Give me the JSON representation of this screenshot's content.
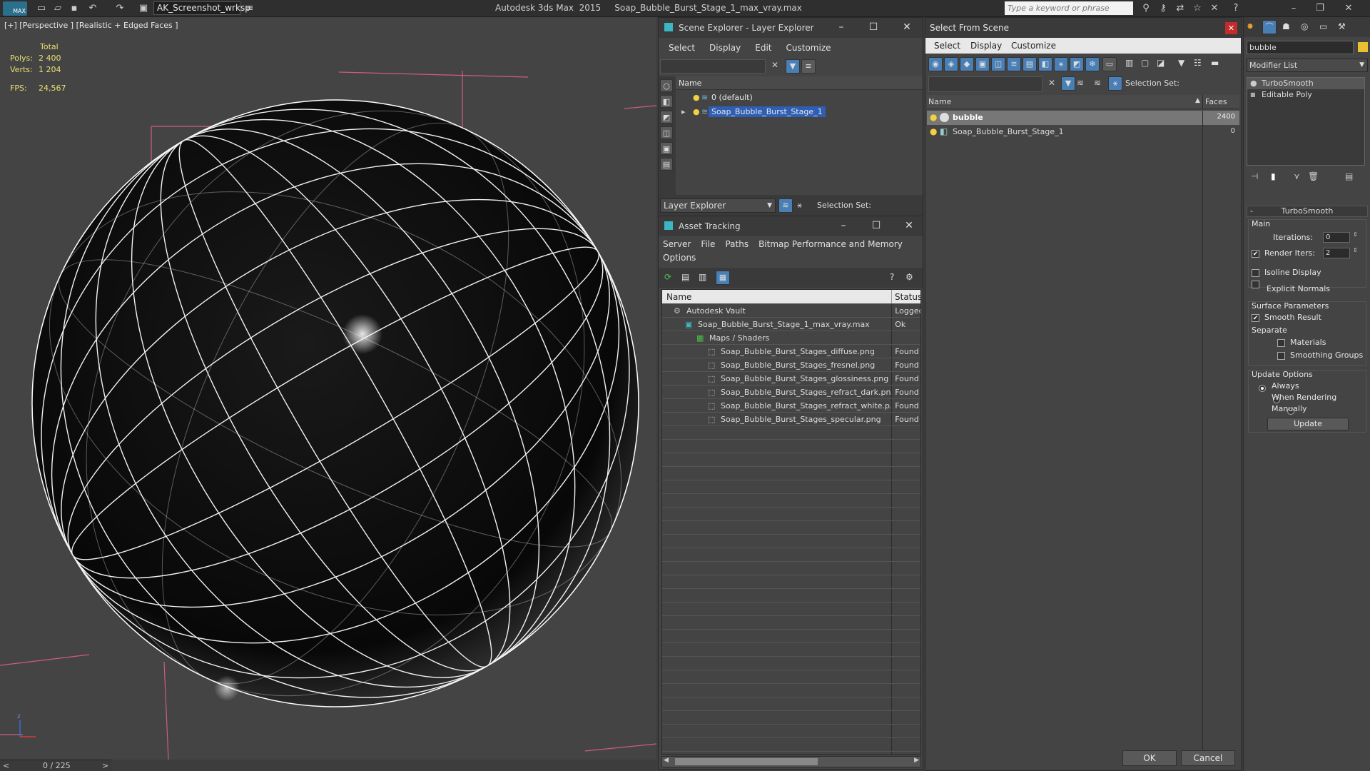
{
  "topbar": {
    "workspace": "AK_Screenshot_wrksp",
    "app_title": "Autodesk 3ds Max  2015",
    "file_title": "Soap_Bubble_Burst_Stage_1_max_vray.max",
    "search_placeholder": "Type a keyword or phrase",
    "max_logo": "MAX"
  },
  "viewport": {
    "label": "[+] [Perspective ] [Realistic + Edged Faces ]",
    "stats_header": "Total",
    "polys_label": "Polys:",
    "polys_value": "2 400",
    "verts_label": "Verts:",
    "verts_value": "1 204",
    "fps_label": "FPS:",
    "fps_value": "24,567",
    "axis_z": "z",
    "timeline": "0 / 225",
    "prev": "<",
    "next": ">"
  },
  "scene_explorer": {
    "title": "Scene Explorer - Layer Explorer",
    "menu": [
      "Select",
      "Display",
      "Edit",
      "Customize"
    ],
    "col_name": "Name",
    "layers": [
      "0 (default)",
      "Soap_Bubble_Burst_Stage_1"
    ],
    "footer_label": "Layer Explorer",
    "selection_set": "Selection Set:"
  },
  "asset_tracking": {
    "title": "Asset Tracking",
    "menu": [
      "Server",
      "File",
      "Paths",
      "Bitmap Performance and Memory"
    ],
    "menu2": "Options",
    "col_name": "Name",
    "col_status": "Status",
    "rows": [
      {
        "name": "Autodesk Vault",
        "status": "Logged",
        "indent": 0
      },
      {
        "name": "Soap_Bubble_Burst_Stage_1_max_vray.max",
        "status": "Ok",
        "indent": 1
      },
      {
        "name": "Maps / Shaders",
        "status": "",
        "indent": 2
      },
      {
        "name": "Soap_Bubble_Burst_Stages_diffuse.png",
        "status": "Found",
        "indent": 3
      },
      {
        "name": "Soap_Bubble_Burst_Stages_fresnel.png",
        "status": "Found",
        "indent": 3
      },
      {
        "name": "Soap_Bubble_Burst_Stages_glossiness.png",
        "status": "Found",
        "indent": 3
      },
      {
        "name": "Soap_Bubble_Burst_Stages_refract_dark.png",
        "status": "Found",
        "indent": 3
      },
      {
        "name": "Soap_Bubble_Burst_Stages_refract_white.p...",
        "status": "Found",
        "indent": 3
      },
      {
        "name": "Soap_Bubble_Burst_Stages_specular.png",
        "status": "Found",
        "indent": 3
      }
    ]
  },
  "select_from_scene": {
    "title": "Select From Scene",
    "menu": [
      "Select",
      "Display",
      "Customize"
    ],
    "selection_set": "Selection Set:",
    "col_name": "Name",
    "col_faces": "Faces",
    "rows": [
      {
        "name": "bubble",
        "faces": "2400"
      },
      {
        "name": "Soap_Bubble_Burst_Stage_1",
        "faces": "0"
      }
    ],
    "ok": "OK",
    "cancel": "Cancel"
  },
  "modify_panel": {
    "object_name": "bubble",
    "modifier_list": "Modifier List",
    "stack": [
      "TurboSmooth",
      "Editable Poly"
    ],
    "rollout_title": "TurboSmooth",
    "main": "Main",
    "iterations_label": "Iterations:",
    "iterations_value": "0",
    "render_iters_label": "Render Iters:",
    "render_iters_value": "2",
    "isoline": "Isoline Display",
    "explicit_normals": "Explicit Normals",
    "surface_params": "Surface Parameters",
    "smooth_result": "Smooth Result",
    "separate": "Separate",
    "materials": "Materials",
    "smoothing_groups": "Smoothing Groups",
    "update_options": "Update Options",
    "always": "Always",
    "when_rendering": "When Rendering",
    "manually": "Manually",
    "update_btn": "Update"
  }
}
